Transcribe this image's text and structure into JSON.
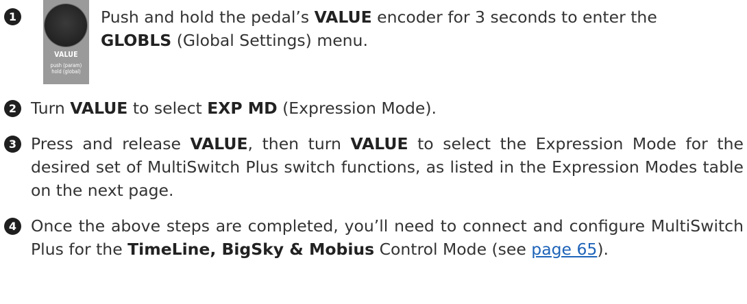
{
  "knob": {
    "label": "VALUE",
    "sub1": "push (param)",
    "sub2": "hold (global)"
  },
  "steps": [
    {
      "number": "1",
      "t1": "Push and hold the pedal’s ",
      "b1": "VALUE",
      "t2": " encoder for 3 seconds to enter the ",
      "b2": "GLOBLS",
      "t3": " (Global Settings) menu."
    },
    {
      "number": "2",
      "t1": "Turn ",
      "b1": "VALUE",
      "t2": " to select ",
      "b2": "EXP MD",
      "t3": " (Expression Mode)."
    },
    {
      "number": "3",
      "t1": "Press and release ",
      "b1": "VALUE",
      "t2": ", then turn ",
      "b2": "VALUE",
      "t3": " to select the Expression Mode for the desired set of MultiSwitch Plus switch functions, as listed in the Expression Modes table on the next page."
    },
    {
      "number": "4",
      "t1": "Once the above steps are completed, you’ll need to connect and configure MultiSwitch Plus for the ",
      "b1": "TimeLine, BigSky & Mobius",
      "t2": " Control Mode (see ",
      "link": "page 65",
      "t3": ")."
    }
  ],
  "colors": {
    "badge": "#1f1f1f",
    "text": "#333333",
    "link": "#1d63b8"
  }
}
